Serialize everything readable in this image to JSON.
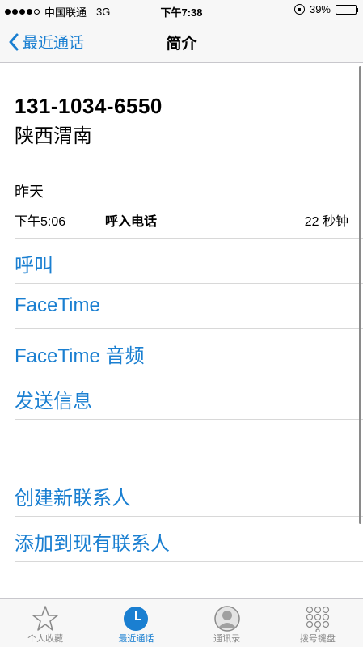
{
  "status_bar": {
    "carrier": "中国联通",
    "network": "3G",
    "time": "下午7:38",
    "battery": "39%",
    "battery_level": 0.39
  },
  "nav": {
    "back_label": "最近通话",
    "title": "简介"
  },
  "caller": {
    "number": "131-1034-6550",
    "location": "陕西渭南"
  },
  "call_log": {
    "date": "昨天",
    "time": "下午5:06",
    "type": "呼入电话",
    "duration": "22 秒钟"
  },
  "actions": {
    "call": "呼叫",
    "facetime": "FaceTime",
    "facetime_audio": "FaceTime 音频",
    "send_message": "发送信息",
    "create_contact": "创建新联系人",
    "add_to_contact": "添加到现有联系人"
  },
  "tabs": [
    {
      "label": "个人收藏",
      "icon": "star-icon",
      "active": false
    },
    {
      "label": "最近通话",
      "icon": "clock-icon",
      "active": true
    },
    {
      "label": "通讯录",
      "icon": "contacts-icon",
      "active": false
    },
    {
      "label": "拨号键盘",
      "icon": "keypad-icon",
      "active": false
    }
  ],
  "colors": {
    "accent": "#1a7fd1",
    "inactive": "#8a8a8a"
  }
}
